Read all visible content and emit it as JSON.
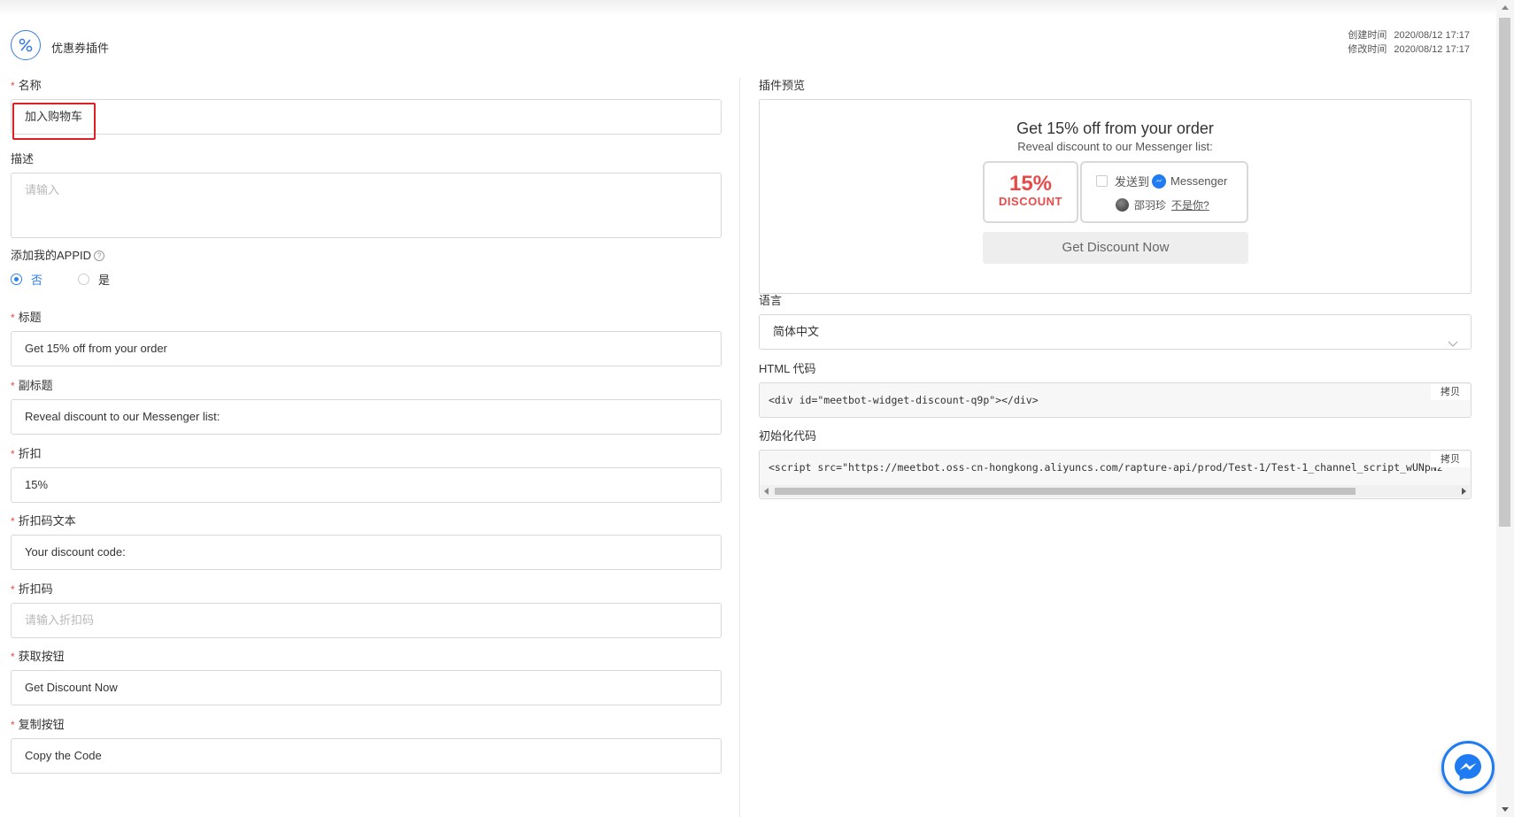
{
  "header": {
    "title": "优惠券插件",
    "created_label": "创建时间",
    "created_value": "2020/08/12 17:17",
    "modified_label": "修改时间",
    "modified_value": "2020/08/12 17:17"
  },
  "form": {
    "name": {
      "label": "名称",
      "value": "加入购物车"
    },
    "description": {
      "label": "描述",
      "placeholder": "请输入"
    },
    "appid": {
      "label": "添加我的APPID",
      "options": [
        "否",
        "是"
      ],
      "selected": "否"
    },
    "title": {
      "label": "标题",
      "value": "Get 15% off from your order"
    },
    "subtitle": {
      "label": "副标题",
      "value": "Reveal discount to our Messenger list:"
    },
    "discount": {
      "label": "折扣",
      "value": "15%"
    },
    "code_text": {
      "label": "折扣码文本",
      "value": "Your discount code:"
    },
    "code": {
      "label": "折扣码",
      "placeholder": "请输入折扣码"
    },
    "get_button": {
      "label": "获取按钮",
      "value": "Get Discount Now"
    },
    "copy_button": {
      "label": "复制按钮",
      "value": "Copy the Code"
    }
  },
  "preview": {
    "label": "插件预览",
    "title": "Get 15% off from your order",
    "subtitle": "Reveal discount to our Messenger list:",
    "discount_pct": "15%",
    "discount_word": "DISCOUNT",
    "send_to": "发送到",
    "messenger": "Messenger",
    "user_name": "邵羽珍",
    "not_you": "不是你?",
    "button": "Get Discount Now"
  },
  "language": {
    "label": "语言",
    "value": "简体中文"
  },
  "html_code": {
    "label": "HTML 代码",
    "code": "<div id=\"meetbot-widget-discount-q9p\"></div>",
    "copy": "拷贝"
  },
  "init_code": {
    "label": "初始化代码",
    "code": "<script src=\"https://meetbot.oss-cn-hongkong.aliyuncs.com/rapture-api/prod/Test-1/Test-1_channel_script_wUNpNz",
    "copy": "拷贝"
  },
  "colors": {
    "accent": "#2f80ed",
    "required": "#e84a4a",
    "highlight": "#e02020",
    "messenger": "#1e7bf2"
  }
}
